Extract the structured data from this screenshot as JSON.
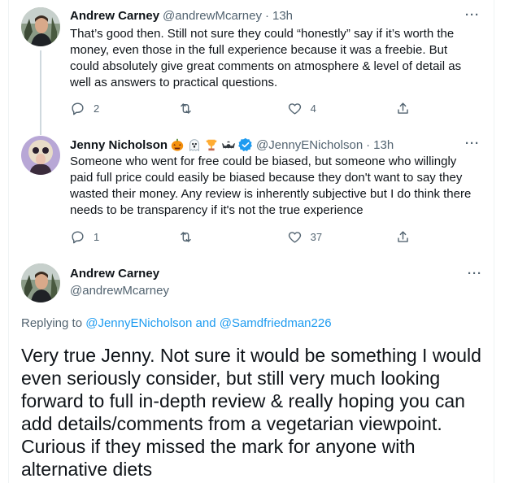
{
  "tweets": [
    {
      "name": "Andrew Carney",
      "handle": "@andrewMcarney",
      "separator": "·",
      "time": "13h",
      "text": "That’s good then. Still not sure they could “honestly” say if it’s worth the money, even those in the full experience because it was a freebie. But could absolutely give great comments on atmosphere & level of detail as well as answers to practical questions.",
      "replies": "2",
      "retweets": "",
      "likes": "4",
      "more": "···"
    },
    {
      "name": "Jenny Nicholson",
      "handle": "@JennyENicholson",
      "separator": "·",
      "time": "13h",
      "text": "Someone who went for free could be biased, but someone who willingly paid full price could easily be biased because they don't want to say they wasted their money. Any review is inherently subjective but I do think there needs to be transparency if it's not the true experience",
      "replies": "1",
      "retweets": "",
      "likes": "37",
      "more": "···",
      "name_emojis": [
        "jack-o-lantern-icon",
        "ghost-icon",
        "trophy-icon",
        "bat-icon"
      ]
    }
  ],
  "focus_tweet": {
    "name": "Andrew Carney",
    "handle": "@andrewMcarney",
    "more": "···",
    "replying_prefix": "Replying to",
    "replying_user1": "@JennyENicholson",
    "replying_and": "and",
    "replying_user2": "@Samdfriedman226",
    "text": "Very true Jenny. Not sure it would be something I would even seriously consider, but still very much looking forward to full in-depth review & really hoping you can add details/comments from a vegetarian viewpoint. Curious if they missed the mark for anyone with alternative diets"
  },
  "colors": {
    "text": "#0f1419",
    "secondary": "#536471",
    "link": "#1d9bf0",
    "thread_line": "#cfd9de",
    "verified": "#1d9bf0"
  }
}
